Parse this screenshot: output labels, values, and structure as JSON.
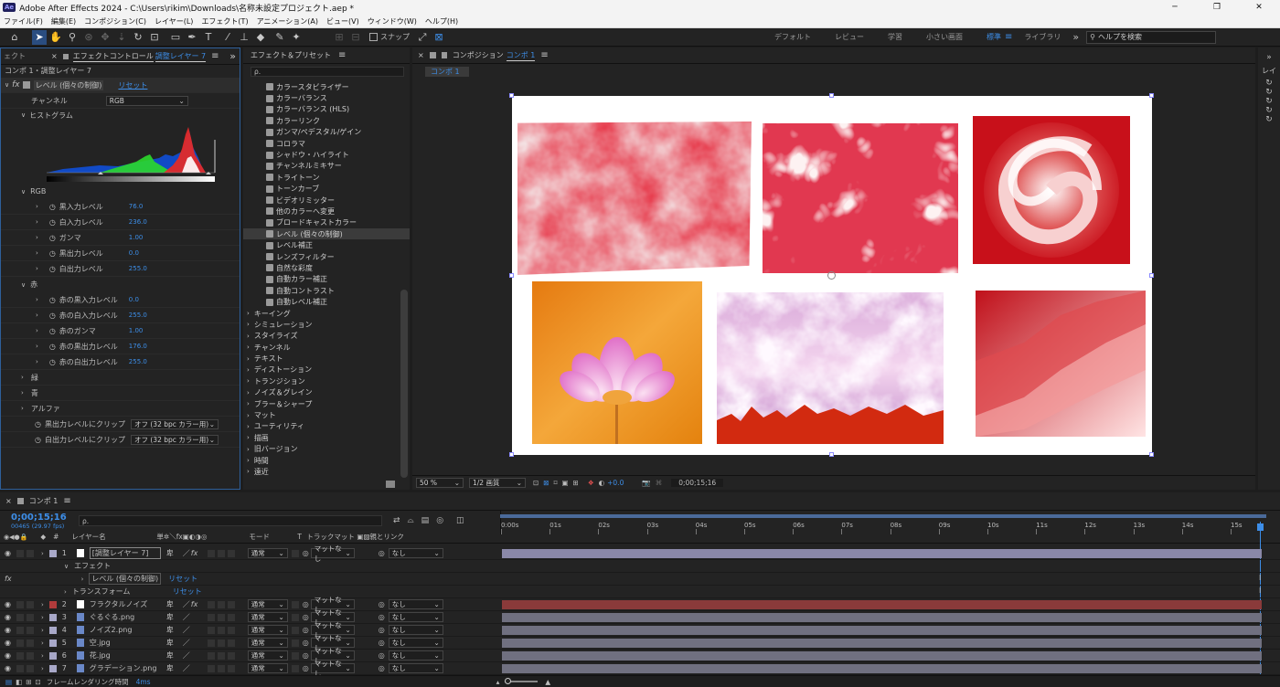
{
  "app": {
    "badge": "Ae",
    "title": "Adobe After Effects 2024 - C:\\Users\\rikim\\Downloads\\名称未設定プロジェクト.aep *"
  },
  "window_controls": {
    "min": "─",
    "max": "❐",
    "close": "✕"
  },
  "menu": [
    "ファイル(F)",
    "編集(E)",
    "コンポジション(C)",
    "レイヤー(L)",
    "エフェクト(T)",
    "アニメーション(A)",
    "ビュー(V)",
    "ウィンドウ(W)",
    "ヘルプ(H)"
  ],
  "toolbar": {
    "snap_label": "スナップ",
    "workspaces": [
      "デフォルト",
      "レビュー",
      "学習",
      "小さい画面",
      "標準",
      "ライブラリ"
    ],
    "active_workspace": "標準",
    "more": "»",
    "search_placeholder": "ヘルプを検索"
  },
  "left_panel": {
    "tab_partial": "ェクト",
    "tab_label": "エフェクトコントロール",
    "tab_layer": "調整レイヤー 7",
    "menu_icon": "≡",
    "expand": "»",
    "breadcrumb": "コンポ 1・調整レイヤー 7",
    "fx_badge": "fx",
    "effect_name": "レベル (個々の制御)",
    "reset": "リセット",
    "channel_label": "チャンネル",
    "channel_value": "RGB",
    "histogram_label": "ヒストグラム",
    "rgb_label": "RGB",
    "rgb_params": [
      {
        "label": "黒入力レベル",
        "value": "76.0"
      },
      {
        "label": "白入力レベル",
        "value": "236.0"
      },
      {
        "label": "ガンマ",
        "value": "1.00"
      },
      {
        "label": "黒出力レベル",
        "value": "0.0"
      },
      {
        "label": "白出力レベル",
        "value": "255.0"
      }
    ],
    "red_label": "赤",
    "red_params": [
      {
        "label": "赤の黒入力レベル",
        "value": "0.0"
      },
      {
        "label": "赤の白入力レベル",
        "value": "255.0"
      },
      {
        "label": "赤のガンマ",
        "value": "1.00"
      },
      {
        "label": "赤の黒出力レベル",
        "value": "176.0"
      },
      {
        "label": "赤の白出力レベル",
        "value": "255.0"
      }
    ],
    "green_label": "緑",
    "blue_label": "青",
    "alpha_label": "アルファ",
    "clip_black_label": "黒出力レベルにクリップ",
    "clip_black_value": "オフ (32 bpc カラー用)",
    "clip_white_label": "白出力レベルにクリップ",
    "clip_white_value": "オフ (32 bpc カラー用)"
  },
  "fx_panel": {
    "title": "エフェクト＆プリセット",
    "menu_icon": "≡",
    "search_placeholder": "ρ.",
    "items": [
      "カラースタビライザー",
      "カラーバランス",
      "カラーバランス (HLS)",
      "カラーリンク",
      "ガンマ/ペデスタル/ゲイン",
      "コロラマ",
      "シャドウ・ハイライト",
      "チャンネルミキサー",
      "トライトーン",
      "トーンカーブ",
      "ビデオリミッター",
      "他のカラーへ変更",
      "ブロードキャストカラー",
      "レベル (個々の制御)",
      "レベル補正",
      "レンズフィルター",
      "自然な彩度",
      "自動カラー補正",
      "自動コントラスト",
      "自動レベル補正"
    ],
    "selected_item": "レベル (個々の制御)",
    "categories": [
      "キーイング",
      "シミュレーション",
      "スタイライズ",
      "チャンネル",
      "テキスト",
      "ディストーション",
      "トランジション",
      "ノイズ＆グレイン",
      "ブラー＆シャープ",
      "マット",
      "ユーティリティ",
      "描画",
      "旧バージョン",
      "時間",
      "遠近"
    ]
  },
  "comp_panel": {
    "title": "コンポジション",
    "comp_name": "コンポ 1",
    "menu_icon": "≡",
    "tab": "コンポ 1",
    "zoom": "50 %",
    "resolution": "1/2 画質",
    "exposure": "+0.0",
    "timecode": "0;00;15;16"
  },
  "timeline": {
    "tab": "コンポ 1",
    "menu_icon": "≡",
    "timecode": "0;00;15;16",
    "frames": "00465 (29.97 fps)",
    "search_placeholder": "ρ.",
    "col_num": "#",
    "col_name": "レイヤー名",
    "col_switches": "単✲＼fx▣◐◑◎",
    "col_mode": "モード",
    "col_t": "T",
    "col_trackmatte": "トラックマット",
    "col_parent": "親とリンク",
    "ruler": [
      "0:00s",
      "01s",
      "02s",
      "03s",
      "04s",
      "05s",
      "06s",
      "07s",
      "08s",
      "09s",
      "10s",
      "11s",
      "12s",
      "13s",
      "14s",
      "15s"
    ],
    "layers": [
      {
        "num": "1",
        "name": "[調整レイヤー 7]",
        "mode": "通常",
        "matte": "マットなし",
        "parent": "なし",
        "color": "#a8a8c8",
        "fx": "fx",
        "bar": "#8a88a8"
      },
      {
        "num": "2",
        "name": "フラクタルノイズ",
        "mode": "通常",
        "matte": "マットなし",
        "parent": "なし",
        "color": "#b23b3b",
        "fx": "fx",
        "bar": "#8a3a3a"
      },
      {
        "num": "3",
        "name": "ぐるぐる.png",
        "mode": "通常",
        "matte": "マットなし",
        "parent": "なし",
        "color": "#a8a8c8",
        "fx": "",
        "bar": "#707080"
      },
      {
        "num": "4",
        "name": "ノイズ2.png",
        "mode": "通常",
        "matte": "マットなし",
        "parent": "なし",
        "color": "#a8a8c8",
        "fx": "",
        "bar": "#707080"
      },
      {
        "num": "5",
        "name": "空.jpg",
        "mode": "通常",
        "matte": "マットなし",
        "parent": "なし",
        "color": "#a8a8c8",
        "fx": "",
        "bar": "#707080"
      },
      {
        "num": "6",
        "name": "花.jpg",
        "mode": "通常",
        "matte": "マットなし",
        "parent": "なし",
        "color": "#a8a8c8",
        "fx": "",
        "bar": "#707080"
      },
      {
        "num": "7",
        "name": "グラデーション.png",
        "mode": "通常",
        "matte": "マットなし",
        "parent": "なし",
        "color": "#a8a8c8",
        "fx": "",
        "bar": "#707080"
      }
    ],
    "effect_group": "エフェクト",
    "effect_row": "レベル (個々の制御)",
    "transform": "トランスフォーム",
    "reset": "リセット",
    "render_label": "フレームレンダリング時間",
    "render_value": "4ms"
  }
}
